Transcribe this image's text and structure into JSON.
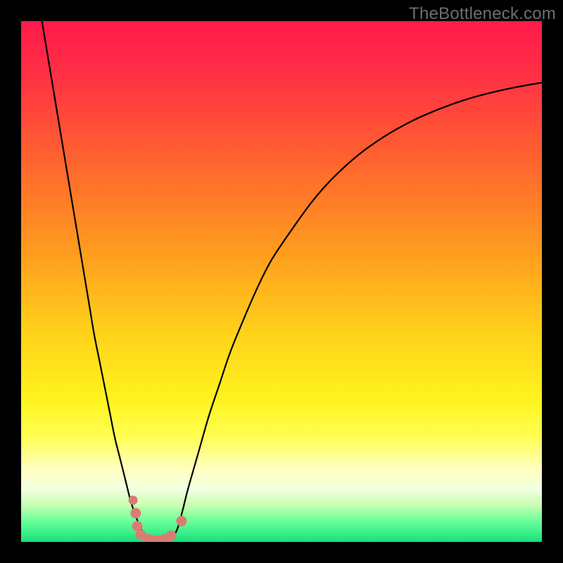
{
  "watermark": "TheBottleneck.com",
  "palette": {
    "frame": "#000000",
    "curve": "#000000",
    "marker_fill": "#d97d73",
    "marker_stroke": "#d97d73"
  },
  "chart_data": {
    "type": "line",
    "title": "",
    "xlabel": "",
    "ylabel": "",
    "xlim": [
      0,
      100
    ],
    "ylim": [
      0,
      100
    ],
    "gradient_stops": [
      {
        "offset": 0.0,
        "color": "#ff1a4b"
      },
      {
        "offset": 0.1,
        "color": "#ff2f44"
      },
      {
        "offset": 0.25,
        "color": "#ff5e31"
      },
      {
        "offset": 0.45,
        "color": "#ff9e1e"
      },
      {
        "offset": 0.6,
        "color": "#ffd21a"
      },
      {
        "offset": 0.73,
        "color": "#fff41f"
      },
      {
        "offset": 0.8,
        "color": "#ffff55"
      },
      {
        "offset": 0.86,
        "color": "#ffffc0"
      },
      {
        "offset": 0.9,
        "color": "#f2ffe0"
      },
      {
        "offset": 0.93,
        "color": "#c7ffb0"
      },
      {
        "offset": 0.96,
        "color": "#6aff9a"
      },
      {
        "offset": 1.0,
        "color": "#15e27a"
      }
    ],
    "series": [
      {
        "name": "bottleneck-curve",
        "x": [
          4,
          5,
          6,
          7,
          8,
          9,
          10,
          11,
          12,
          13,
          14,
          15,
          16,
          17,
          18,
          19,
          20,
          21,
          22,
          23,
          24,
          25,
          26,
          27,
          28,
          29,
          30,
          31,
          32,
          34,
          36,
          38,
          40,
          42,
          45,
          48,
          52,
          56,
          60,
          65,
          70,
          75,
          80,
          85,
          90,
          95,
          100
        ],
        "y": [
          100,
          94,
          88,
          82,
          76,
          70,
          64,
          58,
          52,
          46,
          40,
          35,
          30,
          25,
          20,
          16,
          12,
          8,
          5,
          2.5,
          1.0,
          0.3,
          0.0,
          0.0,
          0.2,
          0.8,
          2.5,
          6,
          10,
          17,
          24,
          30,
          36,
          41,
          48,
          54,
          60,
          65.5,
          70,
          74.5,
          78,
          80.8,
          83,
          84.8,
          86.2,
          87.3,
          88.2
        ]
      }
    ],
    "markers": [
      {
        "x": 21.5,
        "y": 8,
        "r": 6
      },
      {
        "x": 22.0,
        "y": 5.5,
        "r": 7
      },
      {
        "x": 22.3,
        "y": 3.0,
        "r": 7
      },
      {
        "x": 23.0,
        "y": 1.3,
        "r": 7
      },
      {
        "x": 24.5,
        "y": 0.5,
        "r": 7
      },
      {
        "x": 26.0,
        "y": 0.3,
        "r": 7
      },
      {
        "x": 27.5,
        "y": 0.5,
        "r": 7
      },
      {
        "x": 28.8,
        "y": 1.2,
        "r": 7
      },
      {
        "x": 30.8,
        "y": 4.0,
        "r": 7
      }
    ]
  }
}
